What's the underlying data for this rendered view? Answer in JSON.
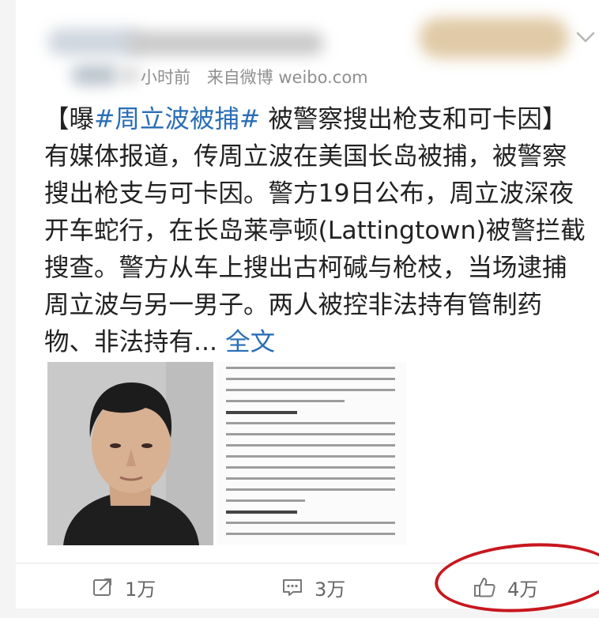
{
  "post": {
    "meta": {
      "time": "小时前",
      "source": "来自微博 weibo.com"
    },
    "text": {
      "part1": "【曝",
      "hashtag": "#周立波被捕#",
      "part2": " 被警察搜出枪支和可卡因】有媒体报道，传周立波在美国长岛被捕，被警察搜出枪支与可卡因。警方19日公布，周立波深夜开车蛇行，在长岛莱亭顿(Lattingtown)被警拦截搜查。警方从车上搜出古柯碱与枪枝，当场逮捕周立波与另一男子。两人被控非法持有管制药物、非法持有... ",
      "more": "全文"
    },
    "images": [
      {
        "icon": "mugshot-photo"
      },
      {
        "icon": "news-document-screenshot"
      }
    ]
  },
  "actions": {
    "repost": {
      "icon": "repost-icon",
      "count": "1万"
    },
    "comment": {
      "icon": "comment-icon",
      "count": "3万"
    },
    "like": {
      "icon": "thumbs-up-icon",
      "count": "4万"
    }
  },
  "colors": {
    "link": "#2a6eb5",
    "annotation": "#c8171e"
  }
}
